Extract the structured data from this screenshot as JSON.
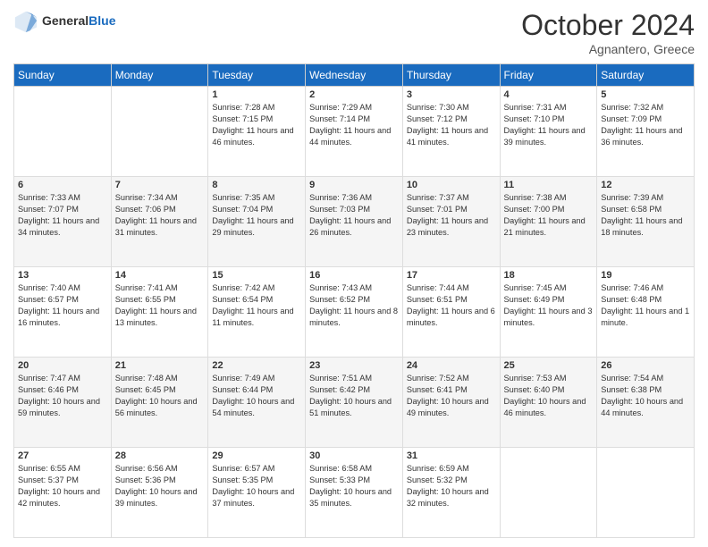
{
  "header": {
    "logo_general": "General",
    "logo_blue": "Blue",
    "month": "October 2024",
    "location": "Agnantero, Greece"
  },
  "days_of_week": [
    "Sunday",
    "Monday",
    "Tuesday",
    "Wednesday",
    "Thursday",
    "Friday",
    "Saturday"
  ],
  "weeks": [
    [
      {
        "day": "",
        "content": ""
      },
      {
        "day": "",
        "content": ""
      },
      {
        "day": "1",
        "content": "Sunrise: 7:28 AM\nSunset: 7:15 PM\nDaylight: 11 hours and 46 minutes."
      },
      {
        "day": "2",
        "content": "Sunrise: 7:29 AM\nSunset: 7:14 PM\nDaylight: 11 hours and 44 minutes."
      },
      {
        "day": "3",
        "content": "Sunrise: 7:30 AM\nSunset: 7:12 PM\nDaylight: 11 hours and 41 minutes."
      },
      {
        "day": "4",
        "content": "Sunrise: 7:31 AM\nSunset: 7:10 PM\nDaylight: 11 hours and 39 minutes."
      },
      {
        "day": "5",
        "content": "Sunrise: 7:32 AM\nSunset: 7:09 PM\nDaylight: 11 hours and 36 minutes."
      }
    ],
    [
      {
        "day": "6",
        "content": "Sunrise: 7:33 AM\nSunset: 7:07 PM\nDaylight: 11 hours and 34 minutes."
      },
      {
        "day": "7",
        "content": "Sunrise: 7:34 AM\nSunset: 7:06 PM\nDaylight: 11 hours and 31 minutes."
      },
      {
        "day": "8",
        "content": "Sunrise: 7:35 AM\nSunset: 7:04 PM\nDaylight: 11 hours and 29 minutes."
      },
      {
        "day": "9",
        "content": "Sunrise: 7:36 AM\nSunset: 7:03 PM\nDaylight: 11 hours and 26 minutes."
      },
      {
        "day": "10",
        "content": "Sunrise: 7:37 AM\nSunset: 7:01 PM\nDaylight: 11 hours and 23 minutes."
      },
      {
        "day": "11",
        "content": "Sunrise: 7:38 AM\nSunset: 7:00 PM\nDaylight: 11 hours and 21 minutes."
      },
      {
        "day": "12",
        "content": "Sunrise: 7:39 AM\nSunset: 6:58 PM\nDaylight: 11 hours and 18 minutes."
      }
    ],
    [
      {
        "day": "13",
        "content": "Sunrise: 7:40 AM\nSunset: 6:57 PM\nDaylight: 11 hours and 16 minutes."
      },
      {
        "day": "14",
        "content": "Sunrise: 7:41 AM\nSunset: 6:55 PM\nDaylight: 11 hours and 13 minutes."
      },
      {
        "day": "15",
        "content": "Sunrise: 7:42 AM\nSunset: 6:54 PM\nDaylight: 11 hours and 11 minutes."
      },
      {
        "day": "16",
        "content": "Sunrise: 7:43 AM\nSunset: 6:52 PM\nDaylight: 11 hours and 8 minutes."
      },
      {
        "day": "17",
        "content": "Sunrise: 7:44 AM\nSunset: 6:51 PM\nDaylight: 11 hours and 6 minutes."
      },
      {
        "day": "18",
        "content": "Sunrise: 7:45 AM\nSunset: 6:49 PM\nDaylight: 11 hours and 3 minutes."
      },
      {
        "day": "19",
        "content": "Sunrise: 7:46 AM\nSunset: 6:48 PM\nDaylight: 11 hours and 1 minute."
      }
    ],
    [
      {
        "day": "20",
        "content": "Sunrise: 7:47 AM\nSunset: 6:46 PM\nDaylight: 10 hours and 59 minutes."
      },
      {
        "day": "21",
        "content": "Sunrise: 7:48 AM\nSunset: 6:45 PM\nDaylight: 10 hours and 56 minutes."
      },
      {
        "day": "22",
        "content": "Sunrise: 7:49 AM\nSunset: 6:44 PM\nDaylight: 10 hours and 54 minutes."
      },
      {
        "day": "23",
        "content": "Sunrise: 7:51 AM\nSunset: 6:42 PM\nDaylight: 10 hours and 51 minutes."
      },
      {
        "day": "24",
        "content": "Sunrise: 7:52 AM\nSunset: 6:41 PM\nDaylight: 10 hours and 49 minutes."
      },
      {
        "day": "25",
        "content": "Sunrise: 7:53 AM\nSunset: 6:40 PM\nDaylight: 10 hours and 46 minutes."
      },
      {
        "day": "26",
        "content": "Sunrise: 7:54 AM\nSunset: 6:38 PM\nDaylight: 10 hours and 44 minutes."
      }
    ],
    [
      {
        "day": "27",
        "content": "Sunrise: 6:55 AM\nSunset: 5:37 PM\nDaylight: 10 hours and 42 minutes."
      },
      {
        "day": "28",
        "content": "Sunrise: 6:56 AM\nSunset: 5:36 PM\nDaylight: 10 hours and 39 minutes."
      },
      {
        "day": "29",
        "content": "Sunrise: 6:57 AM\nSunset: 5:35 PM\nDaylight: 10 hours and 37 minutes."
      },
      {
        "day": "30",
        "content": "Sunrise: 6:58 AM\nSunset: 5:33 PM\nDaylight: 10 hours and 35 minutes."
      },
      {
        "day": "31",
        "content": "Sunrise: 6:59 AM\nSunset: 5:32 PM\nDaylight: 10 hours and 32 minutes."
      },
      {
        "day": "",
        "content": ""
      },
      {
        "day": "",
        "content": ""
      }
    ]
  ]
}
